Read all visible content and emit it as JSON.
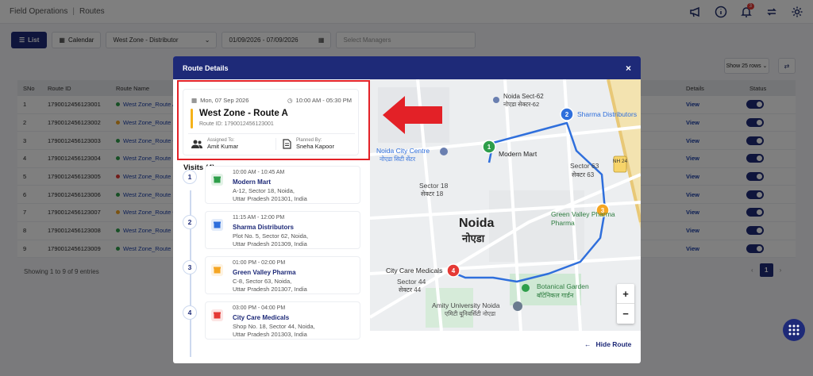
{
  "breadcrumb": {
    "root": "Field Operations",
    "current": "Routes"
  },
  "topbar": {
    "notification_count": "3"
  },
  "toolbar": {
    "list_label": "List",
    "calendar_label": "Calendar",
    "zone": "West Zone - Distributor",
    "date_range": "01/09/2026 - 07/09/2026",
    "managers_placeholder": "Select Managers"
  },
  "table": {
    "show_rows": "Show 25 rows",
    "headers": {
      "sno": "SNo",
      "route_id": "Route ID",
      "route_name": "Route Name",
      "details": "Details",
      "status": "Status"
    },
    "rows": [
      {
        "sno": "1",
        "id": "1790012456123001",
        "name": "West Zone_Route A",
        "status": "green",
        "details": "View"
      },
      {
        "sno": "2",
        "id": "1790012456123002",
        "name": "West Zone_Route B",
        "status": "yellow",
        "details": "View"
      },
      {
        "sno": "3",
        "id": "1790012456123003",
        "name": "West Zone_Route C",
        "status": "green",
        "details": "View"
      },
      {
        "sno": "4",
        "id": "1790012456123004",
        "name": "West Zone_Route D",
        "status": "green",
        "details": "View"
      },
      {
        "sno": "5",
        "id": "1790012456123005",
        "name": "West Zone_Route E",
        "status": "red",
        "details": "View"
      },
      {
        "sno": "6",
        "id": "1790012456123006",
        "name": "West Zone_Route F",
        "status": "green",
        "details": "View"
      },
      {
        "sno": "7",
        "id": "1790012456123007",
        "name": "West Zone_Route G",
        "status": "yellow",
        "details": "View"
      },
      {
        "sno": "8",
        "id": "1790012456123008",
        "name": "West Zone_Route H",
        "status": "green",
        "details": "View"
      },
      {
        "sno": "9",
        "id": "1790012456123009",
        "name": "West Zone_Route I",
        "status": "green",
        "details": "View"
      }
    ],
    "showing": "Showing 1 to 9 of 9 entries",
    "page": "1"
  },
  "status_colors": {
    "green": "#2e9e4a",
    "yellow": "#f5a623",
    "red": "#e53935"
  },
  "modal": {
    "title": "Route Details",
    "close": "×",
    "date": "Mon, 07 Sep 2026",
    "time": "10:00 AM - 05:30 PM",
    "route_name": "West Zone - Route A",
    "route_id": "Route ID: 1790012456123001",
    "assigned_label": "Assigned To:",
    "assigned_value": "Amit Kumar",
    "planned_label": "Planned By:",
    "planned_value": "Sneha Kapoor",
    "visits_title": "Visits (4)",
    "hide_route": "Hide Route",
    "visits": [
      {
        "num": "1",
        "time": "10:00 AM - 10:45 AM",
        "name": "Modern Mart",
        "addr1": "A-12, Sector 18, Noida,",
        "addr2": "Uttar Pradesh 201301, India",
        "color": "#2e9e4a"
      },
      {
        "num": "2",
        "time": "11:15 AM - 12:00 PM",
        "name": "Sharma Distributors",
        "addr1": "Plot No. 5, Sector 62, Noida,",
        "addr2": "Uttar Pradesh 201309, India",
        "color": "#2f6fdc"
      },
      {
        "num": "3",
        "time": "01:00 PM - 02:00 PM",
        "name": "Green Valley Pharma",
        "addr1": "C-8, Sector 63, Noida,",
        "addr2": "Uttar Pradesh 201307, India",
        "color": "#f5a623"
      },
      {
        "num": "4",
        "time": "03:00 PM - 04:00 PM",
        "name": "City Care Medicals",
        "addr1": "Shop No. 18, Sector 44, Noida,",
        "addr2": "Uttar Pradesh 201303, India",
        "color": "#e53935"
      }
    ]
  },
  "map": {
    "labels": {
      "sect62_en": "Noida Sect-62",
      "sect62_hi": "नोएडा सेक्टर-62",
      "city_centre_en": "Noida City Centre",
      "city_centre_hi": "नोएडा सिटी सेंटर",
      "sector18_en": "Sector 18",
      "sector18_hi": "सेक्टर 18",
      "sector63_en": "Sector 63",
      "sector63_hi": "सेक्टर 63",
      "noida_en": "Noida",
      "noida_hi": "नोएडा",
      "sector44_en": "Sector 44",
      "sector44_hi": "सेक्टर 44",
      "botanical_en": "Botanical Garden",
      "botanical_hi": "बॉटेनिकल गार्डन",
      "amity_en": "Amity University Noida",
      "amity_hi": "एमिटी यूनिवर्सिटी नोएडा",
      "nh24": "NH 24",
      "modern_mart": "Modern Mart",
      "sharma": "Sharma Distributors",
      "green_valley": "Green Valley Pharma",
      "city_care": "City Care Medicals"
    },
    "zoom_in": "+",
    "zoom_out": "−"
  }
}
